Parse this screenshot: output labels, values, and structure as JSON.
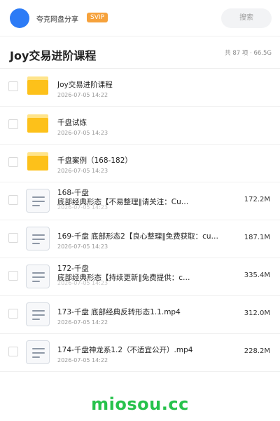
{
  "header": {
    "username": "夸克网盘分享",
    "badge": "SVIP",
    "search_placeholder": "搜索"
  },
  "folder": {
    "title": "Joy交易进阶课程",
    "summary": "共 87 项 · 66.5G"
  },
  "items": [
    {
      "type": "folder",
      "name": "Joy交易进阶课程",
      "date": "2026-07-05 14:22",
      "size": ""
    },
    {
      "type": "folder",
      "name": "千盘试炼",
      "date": "2026-07-05 14:23",
      "size": ""
    },
    {
      "type": "folder",
      "name": "千盘案例（168-182）",
      "date": "2026-07-05 14:23",
      "size": ""
    },
    {
      "type": "file",
      "name_line1": "168-千盘",
      "name_line2": "底部经典形态【不易整理‖请关注：Cu…",
      "date": "2026-07-05 14:23",
      "size": "172.2M"
    },
    {
      "type": "file",
      "name": "169-千盘 底部形态2【良心整理‖免费获取：cu…",
      "date": "2026-07-05 14:23",
      "size": "187.1M"
    },
    {
      "type": "file",
      "name_line1": "172-千盘",
      "name_line2": "底部经典形态【持续更新‖免费提供：c…",
      "date": "2026-07-05 14:23",
      "size": "335.4M"
    },
    {
      "type": "file",
      "name": "173-千盘 底部经典反转形态1.1.mp4",
      "date": "2026-07-05 14:22",
      "size": "312.0M"
    },
    {
      "type": "file",
      "name": "174-千盘神龙系1.2（不适宜公开）.mp4",
      "date": "2026-07-05 14:22",
      "size": "228.2M"
    }
  ],
  "watermark": "miosou.cc",
  "colors": {
    "avatar": "#2c7bf6",
    "badge": "#f6a23c",
    "folder": "#fdc11a",
    "watermark": "#27c24c"
  }
}
